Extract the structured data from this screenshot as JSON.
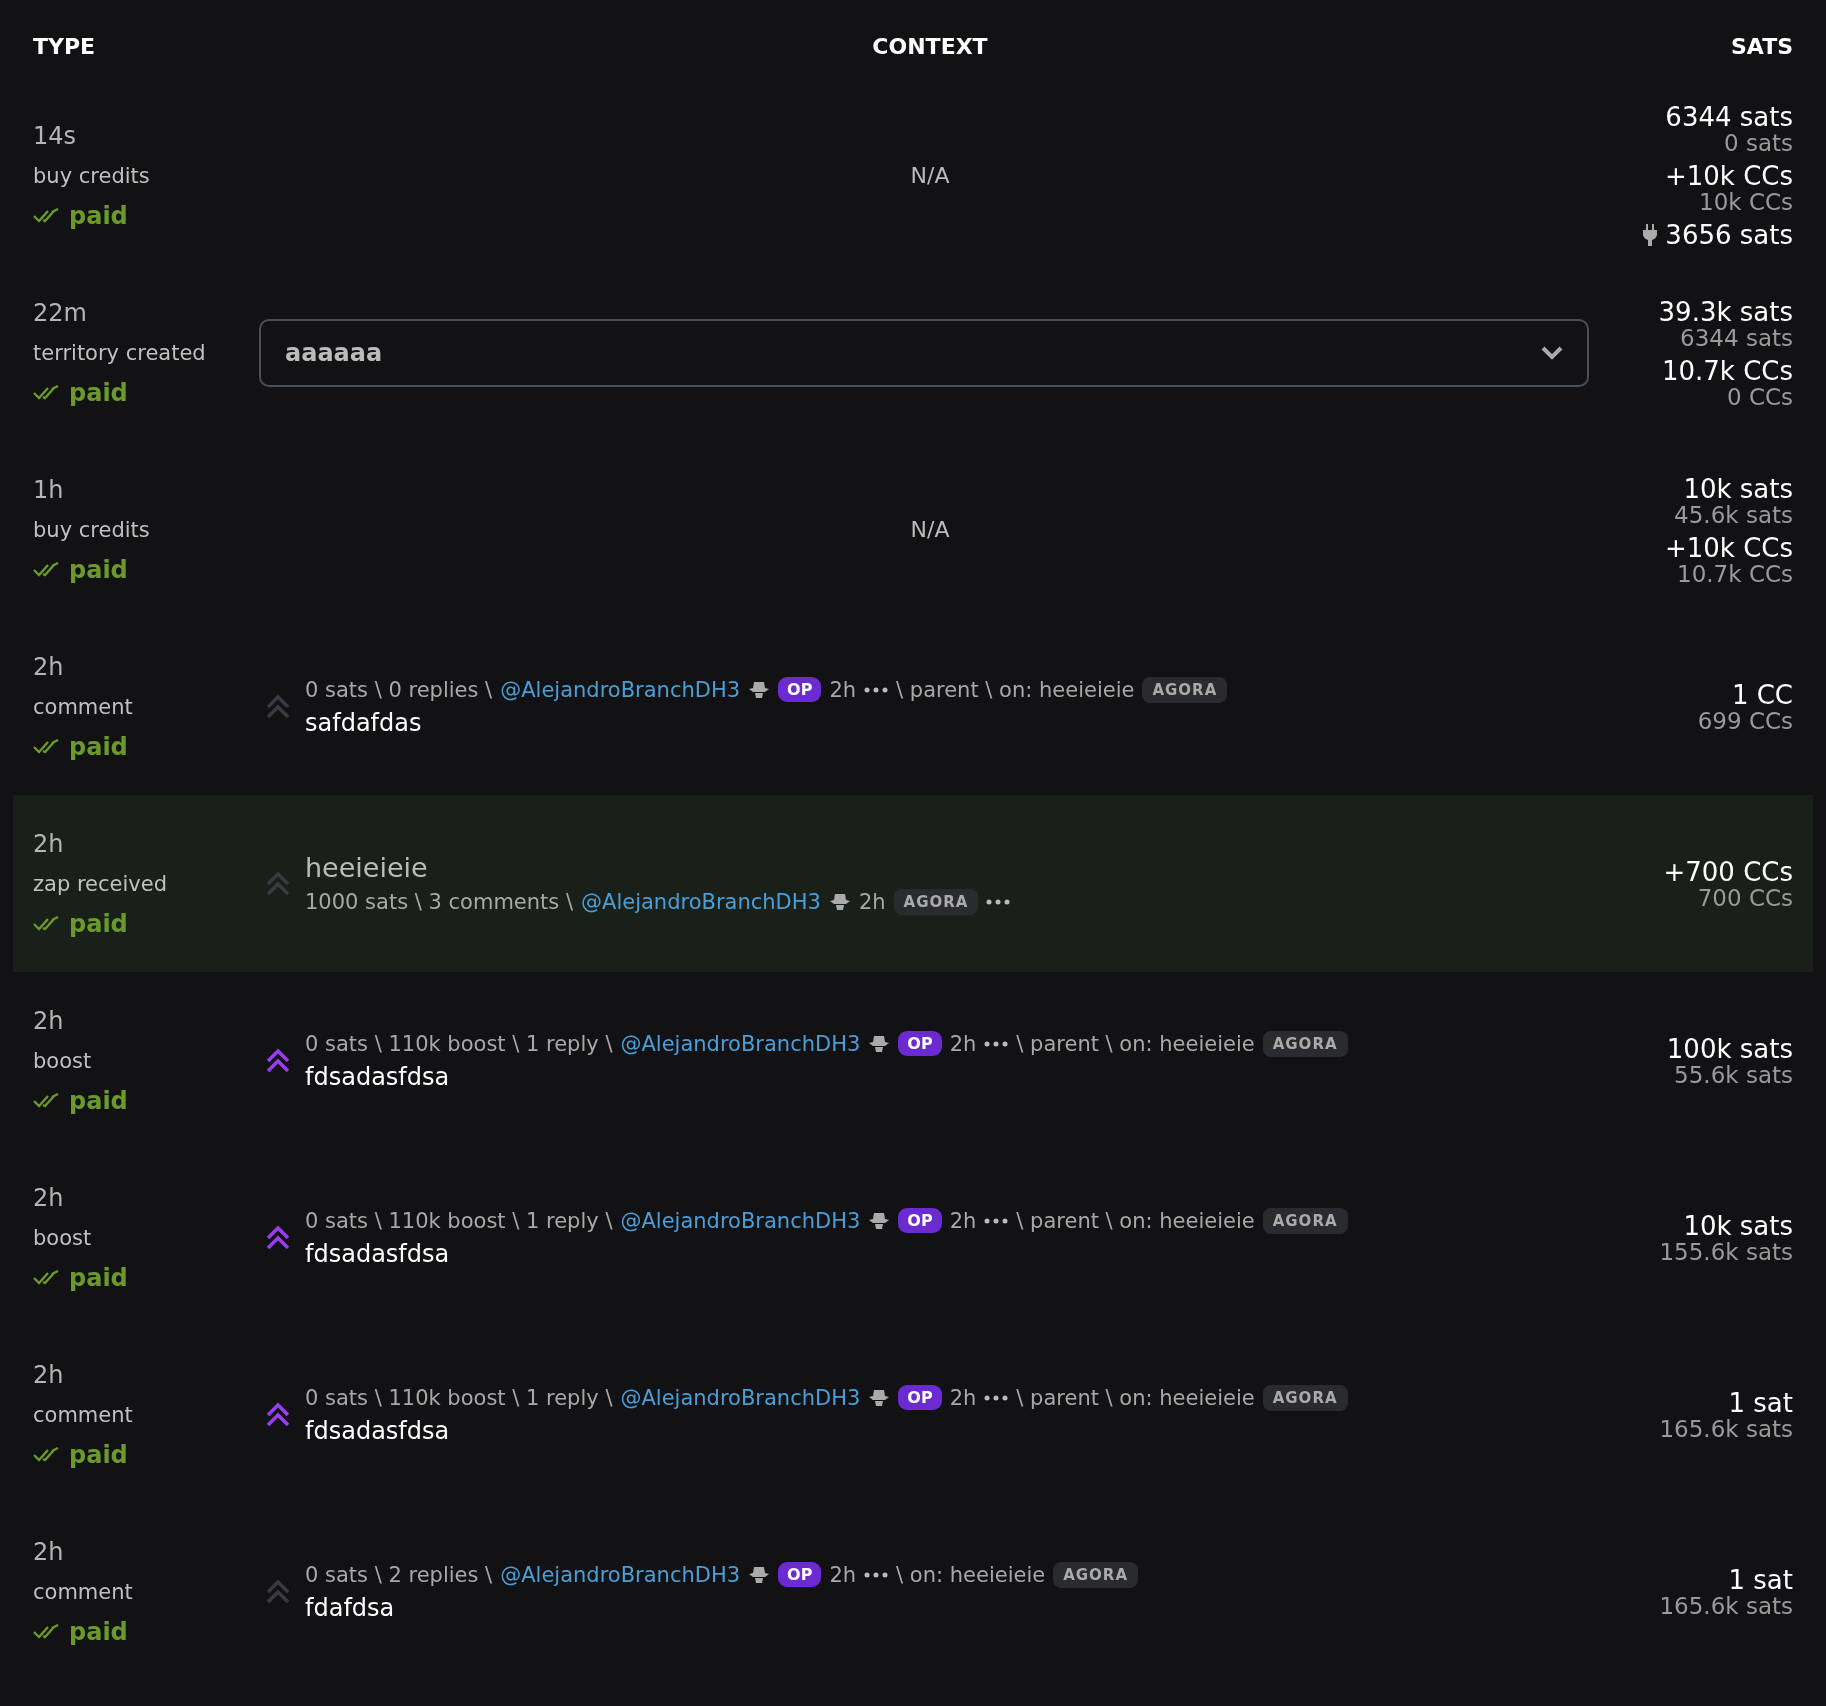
{
  "columns": [
    "TYPE",
    "CONTEXT",
    "SATS"
  ],
  "rows": [
    {
      "time": "14s",
      "type": "buy credits",
      "status": "paid",
      "highlighted": false,
      "context": {
        "kind": "na",
        "text": "N/A"
      },
      "sats": [
        {
          "amount": "6344 sats",
          "balance": "0 sats"
        },
        {
          "amount": "+10k CCs",
          "balance": "10k CCs"
        },
        {
          "amount": "3656 sats",
          "plug": true
        }
      ]
    },
    {
      "time": "22m",
      "type": "territory created",
      "status": "paid",
      "highlighted": false,
      "context": {
        "kind": "select",
        "value": "aaaaaa"
      },
      "sats": [
        {
          "amount": "39.3k sats",
          "balance": "6344 sats"
        },
        {
          "amount": "10.7k CCs",
          "balance": "0 CCs"
        }
      ]
    },
    {
      "time": "1h",
      "type": "buy credits",
      "status": "paid",
      "highlighted": false,
      "context": {
        "kind": "na",
        "text": "N/A"
      },
      "sats": [
        {
          "amount": "10k sats",
          "balance": "45.6k sats"
        },
        {
          "amount": "+10k CCs",
          "balance": "10.7k CCs"
        }
      ]
    },
    {
      "time": "2h",
      "type": "comment",
      "status": "paid",
      "highlighted": false,
      "context": {
        "kind": "item",
        "boosted": false,
        "meta": [
          {
            "kind": "text",
            "text": "0 sats \\ 0 replies \\"
          },
          {
            "kind": "link",
            "text": "@AlejandroBranchDH3"
          },
          {
            "kind": "hat"
          },
          {
            "kind": "op",
            "text": "OP"
          },
          {
            "kind": "text",
            "text": "2h"
          },
          {
            "kind": "dots"
          },
          {
            "kind": "text",
            "text": "\\ parent \\ on: heeieieie"
          },
          {
            "kind": "tag",
            "text": "AGORA"
          }
        ],
        "body": "safdafdas"
      },
      "sats": [
        {
          "amount": "1 CC",
          "balance": "699 CCs"
        }
      ]
    },
    {
      "time": "2h",
      "type": "zap received",
      "status": "paid",
      "highlighted": true,
      "context": {
        "kind": "item",
        "boosted": false,
        "title": "heeieieie",
        "meta": [
          {
            "kind": "text",
            "text": "1000 sats \\ 3 comments \\"
          },
          {
            "kind": "link",
            "text": "@AlejandroBranchDH3"
          },
          {
            "kind": "hat"
          },
          {
            "kind": "text",
            "text": "2h"
          },
          {
            "kind": "tag",
            "text": "AGORA"
          },
          {
            "kind": "dots"
          }
        ]
      },
      "sats": [
        {
          "amount": "+700 CCs",
          "balance": "700 CCs"
        }
      ]
    },
    {
      "time": "2h",
      "type": "boost",
      "status": "paid",
      "highlighted": false,
      "context": {
        "kind": "item",
        "boosted": true,
        "meta": [
          {
            "kind": "text",
            "text": "0 sats \\ 110k boost \\ 1 reply \\"
          },
          {
            "kind": "link",
            "text": "@AlejandroBranchDH3"
          },
          {
            "kind": "hat"
          },
          {
            "kind": "op",
            "text": "OP"
          },
          {
            "kind": "text",
            "text": "2h"
          },
          {
            "kind": "dots"
          },
          {
            "kind": "text",
            "text": "\\ parent \\ on: heeieieie"
          },
          {
            "kind": "tag",
            "text": "AGORA"
          }
        ],
        "body": "fdsadasfdsa"
      },
      "sats": [
        {
          "amount": "100k sats",
          "balance": "55.6k sats"
        }
      ]
    },
    {
      "time": "2h",
      "type": "boost",
      "status": "paid",
      "highlighted": false,
      "context": {
        "kind": "item",
        "boosted": true,
        "meta": [
          {
            "kind": "text",
            "text": "0 sats \\ 110k boost \\ 1 reply \\"
          },
          {
            "kind": "link",
            "text": "@AlejandroBranchDH3"
          },
          {
            "kind": "hat"
          },
          {
            "kind": "op",
            "text": "OP"
          },
          {
            "kind": "text",
            "text": "2h"
          },
          {
            "kind": "dots"
          },
          {
            "kind": "text",
            "text": "\\ parent \\ on: heeieieie"
          },
          {
            "kind": "tag",
            "text": "AGORA"
          }
        ],
        "body": "fdsadasfdsa"
      },
      "sats": [
        {
          "amount": "10k sats",
          "balance": "155.6k sats"
        }
      ]
    },
    {
      "time": "2h",
      "type": "comment",
      "status": "paid",
      "highlighted": false,
      "context": {
        "kind": "item",
        "boosted": true,
        "meta": [
          {
            "kind": "text",
            "text": "0 sats \\ 110k boost \\ 1 reply \\"
          },
          {
            "kind": "link",
            "text": "@AlejandroBranchDH3"
          },
          {
            "kind": "hat"
          },
          {
            "kind": "op",
            "text": "OP"
          },
          {
            "kind": "text",
            "text": "2h"
          },
          {
            "kind": "dots"
          },
          {
            "kind": "text",
            "text": "\\ parent \\ on: heeieieie"
          },
          {
            "kind": "tag",
            "text": "AGORA"
          }
        ],
        "body": "fdsadasfdsa"
      },
      "sats": [
        {
          "amount": "1 sat",
          "balance": "165.6k sats"
        }
      ]
    },
    {
      "time": "2h",
      "type": "comment",
      "status": "paid",
      "highlighted": false,
      "context": {
        "kind": "item",
        "boosted": false,
        "meta": [
          {
            "kind": "text",
            "text": "0 sats \\ 2 replies \\"
          },
          {
            "kind": "link",
            "text": "@AlejandroBranchDH3"
          },
          {
            "kind": "hat"
          },
          {
            "kind": "op",
            "text": "OP"
          },
          {
            "kind": "text",
            "text": "2h"
          },
          {
            "kind": "dots"
          },
          {
            "kind": "text",
            "text": "\\ on: heeieieie"
          },
          {
            "kind": "tag",
            "text": "AGORA"
          }
        ],
        "body": "fdafdsa"
      },
      "sats": [
        {
          "amount": "1 sat",
          "balance": "165.6k sats"
        }
      ]
    }
  ]
}
